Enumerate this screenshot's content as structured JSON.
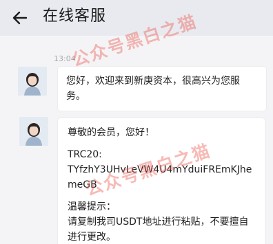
{
  "header": {
    "back_icon": "arrow-left-icon",
    "title": "在线客服"
  },
  "chat": {
    "timestamp": "13:04",
    "messages": [
      {
        "avatar": "agent-avatar",
        "text": "您好，欢迎来到新庚资本，很高兴为您服务。"
      },
      {
        "avatar": "agent-avatar",
        "greeting": "尊敬的会员，您好！",
        "network_label": "TRC20:",
        "address": "TYfzhY3UHvLeVW4U4mYduiFREmKJhemeGB",
        "tip_label": "温馨提示：",
        "tip_text": "请复制我司USDT地址进行粘贴，不要擅自进行更改。"
      }
    ]
  },
  "watermark": "公众号黑白之猫",
  "colors": {
    "header_bg": "#e9eaf0",
    "page_bg": "#f4f4f6",
    "bubble_bg": "#ffffff",
    "watermark": "#ec5a50"
  }
}
